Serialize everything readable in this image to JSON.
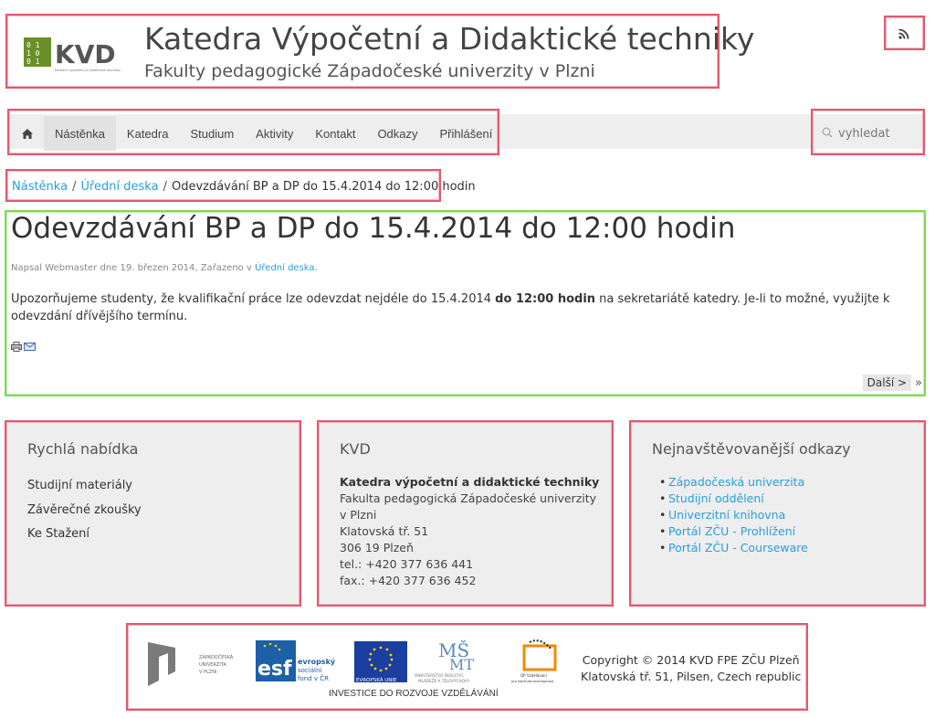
{
  "header": {
    "logo_text": "KVD",
    "logo_subtext": "Katedra výpočetní a didaktické techniky",
    "title": "Katedra Výpočetní a Didaktické techniky",
    "subtitle": "Fakulty pedagogické Západočeské univerzity v Plzni",
    "rss_icon": "rss-icon"
  },
  "nav": {
    "home_icon": "home-icon",
    "items": [
      {
        "label": "Nástěnka"
      },
      {
        "label": "Katedra"
      },
      {
        "label": "Studium"
      },
      {
        "label": "Aktivity"
      },
      {
        "label": "Kontakt"
      },
      {
        "label": "Odkazy"
      },
      {
        "label": "Přihlášení"
      }
    ]
  },
  "search": {
    "placeholder": "vyhledat"
  },
  "breadcrumb": {
    "items": [
      "Nástěnka",
      "Úřední deska"
    ],
    "current": "Odevzdávání BP a DP do 15.4.2014 do 12:00 hodin"
  },
  "article": {
    "title": "Odevzdávání BP a DP do 15.4.2014 do 12:00 hodin",
    "meta_prefix": "Napsal Webmaster dne 19. březen 2014, Zařazeno v",
    "meta_category": "Úřední deska.",
    "body_before": "Upozorňujeme studenty, že kvalifikační práce lze odevzdat nejdéle do 15.4.2014 ",
    "body_bold": "do 12:00 hodin",
    "body_after": " na sekretariátě katedry. Je-li to možné, využijte k odevzdání dřívějšího termínu.",
    "next_label": "Další >",
    "next_arrow": "»"
  },
  "columns": {
    "quick": {
      "title": "Rychlá nabídka",
      "items": [
        "Studijní materiály",
        "Závěrečné zkoušky",
        "Ke Stažení"
      ]
    },
    "kvd": {
      "title": "KVD",
      "name": "Katedra výpočetní a didaktické techniky",
      "lines": [
        "Fakulta pedagogická Západočeské univerzity v Plzni",
        "Klatovská tř. 51",
        "306 19 Plzeň",
        "tel.: +420 377 636 441",
        "fax.: +420 377 636 452"
      ]
    },
    "links": {
      "title": "Nejnavštěvovanější odkazy",
      "items": [
        "Západočeská univerzita",
        "Studijní oddělení",
        "Univerzitní knihovna",
        "Portál ZČU - Prohlížení",
        "Portál ZČU - Courseware"
      ]
    }
  },
  "footer": {
    "zcu_text": "ZÁPADOČESKÁ UNIVERZITA V PLZNI",
    "esf_line1": "evropský",
    "esf_line2": "sociální",
    "esf_line3": "fond v ČR",
    "eu_text": "EVROPSKÁ UNIE",
    "msmt_text": "MINISTERSTVO ŠKOLSTVÍ, MLÁDEŽE A TĚLOVÝCHOVY",
    "op_text": "OP Vzdělávání pro konkurenceschopnost",
    "investice": "INVESTICE DO ROZVOJE VZDĚLÁVÁNÍ",
    "copyright_line1": "Copyright © 2014 KVD FPE ZČU Plzeň",
    "copyright_line2": "Klatovská tř. 51, Pilsen, Czech republic"
  },
  "colors": {
    "accent": "#2a9fd6",
    "annotation_red": "#e05a6e",
    "annotation_green": "#7ed957",
    "logo_green": "#6a8f2a"
  }
}
